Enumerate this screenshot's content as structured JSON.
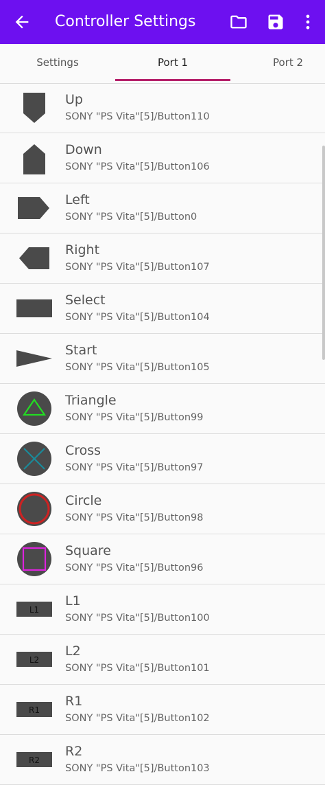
{
  "appbar": {
    "title": "Controller Settings",
    "background": "#6d10f0",
    "icons": [
      "back-arrow-icon",
      "folder-icon",
      "save-icon",
      "overflow-menu-icon"
    ]
  },
  "tabs": [
    {
      "label": "Settings",
      "active": false
    },
    {
      "label": "Port 1",
      "active": true
    },
    {
      "label": "Port 2",
      "active": false
    }
  ],
  "accent": "#b5206a",
  "buttons": [
    {
      "name": "Up",
      "binding": "SONY \"PS Vita\"[5]/Button110",
      "icon": "dpad-up-icon"
    },
    {
      "name": "Down",
      "binding": "SONY \"PS Vita\"[5]/Button106",
      "icon": "dpad-down-icon"
    },
    {
      "name": "Left",
      "binding": "SONY \"PS Vita\"[5]/Button0",
      "icon": "dpad-left-icon"
    },
    {
      "name": "Right",
      "binding": "SONY \"PS Vita\"[5]/Button107",
      "icon": "dpad-right-icon"
    },
    {
      "name": "Select",
      "binding": "SONY \"PS Vita\"[5]/Button104",
      "icon": "select-button-icon"
    },
    {
      "name": "Start",
      "binding": "SONY \"PS Vita\"[5]/Button105",
      "icon": "start-button-icon"
    },
    {
      "name": "Triangle",
      "binding": "SONY \"PS Vita\"[5]/Button99",
      "icon": "triangle-button-icon"
    },
    {
      "name": "Cross",
      "binding": "SONY \"PS Vita\"[5]/Button97",
      "icon": "cross-button-icon"
    },
    {
      "name": "Circle",
      "binding": "SONY \"PS Vita\"[5]/Button98",
      "icon": "circle-button-icon"
    },
    {
      "name": "Square",
      "binding": "SONY \"PS Vita\"[5]/Button96",
      "icon": "square-button-icon"
    },
    {
      "name": "L1",
      "binding": "SONY \"PS Vita\"[5]/Button100",
      "icon": "l1-button-icon",
      "badge": "L1"
    },
    {
      "name": "L2",
      "binding": "SONY \"PS Vita\"[5]/Button101",
      "icon": "l2-button-icon",
      "badge": "L2"
    },
    {
      "name": "R1",
      "binding": "SONY \"PS Vita\"[5]/Button102",
      "icon": "r1-button-icon",
      "badge": "R1"
    },
    {
      "name": "R2",
      "binding": "SONY \"PS Vita\"[5]/Button103",
      "icon": "r2-button-icon",
      "badge": "R2"
    }
  ]
}
